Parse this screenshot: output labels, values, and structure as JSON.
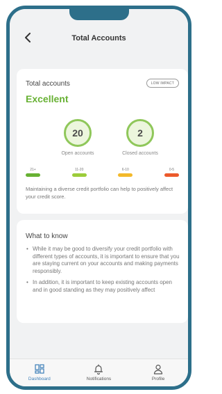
{
  "header": {
    "title": "Total Accounts",
    "back_icon": "chevron-left-icon"
  },
  "summary": {
    "title": "Total accounts",
    "badge": "LOW IMPACT",
    "rating": "Excellent",
    "rating_color": "#67b133",
    "stats": [
      {
        "value": "20",
        "label": "Open accounts"
      },
      {
        "value": "2",
        "label": "Closed accounts"
      }
    ],
    "scale": [
      {
        "label": "21+",
        "color": "#67b133"
      },
      {
        "label": "11-20",
        "color": "#9ccc3a"
      },
      {
        "label": "6-10",
        "color": "#f3b92b"
      },
      {
        "label": "0-5",
        "color": "#ec5a2c"
      }
    ],
    "description": "Maintaining a diverse credit portfolio can help to positively affect your credit score."
  },
  "info": {
    "title": "What to know",
    "bullets": [
      "While it may be good to diversify your credit portfolio with different types of accounts, it is important to ensure that you are staying current on your accounts and making payments responsibly.",
      "In addition, it is important to keep existing accounts open and in good standing as they may positively affect"
    ]
  },
  "tabs": [
    {
      "label": "Dashboard",
      "icon": "dashboard-icon",
      "active": true
    },
    {
      "label": "Notifications",
      "icon": "bell-icon",
      "active": false
    },
    {
      "label": "Profile",
      "icon": "user-icon",
      "active": false
    }
  ],
  "colors": {
    "frame": "#2d6f8a",
    "accent": "#3c7fb8",
    "circle_border": "#8fc75a"
  }
}
